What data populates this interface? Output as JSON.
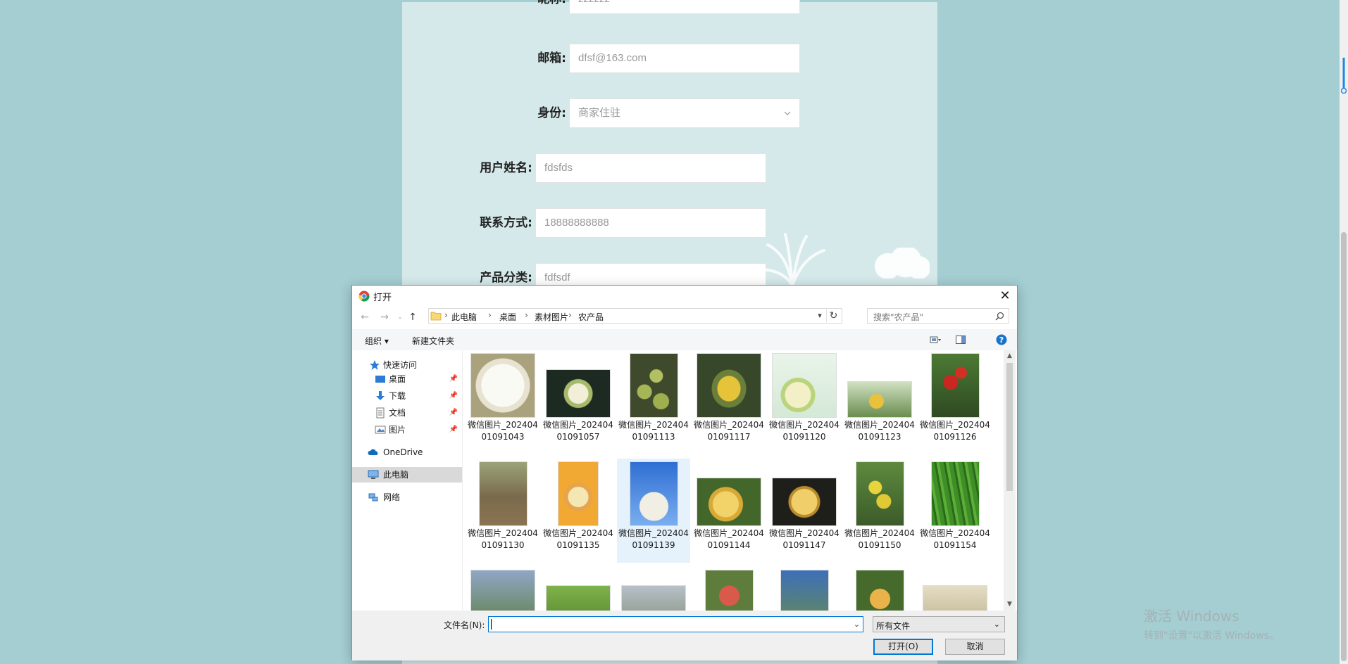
{
  "form": {
    "nickname": {
      "label": "昵称:",
      "value": "zzzzzz"
    },
    "email": {
      "label": "邮箱:",
      "value": "dfsf@163.com"
    },
    "identity": {
      "label": "身份:",
      "value": "商家住驻"
    },
    "username": {
      "label": "用户姓名:",
      "value": "fdsfds"
    },
    "contact": {
      "label": "联系方式:",
      "value": "18888888888"
    },
    "category": {
      "label": "产品分类:",
      "value": "fdfsdf"
    }
  },
  "watermark": {
    "line1": "激活 Windows",
    "line2": "转到\"设置\"以激活 Windows。"
  },
  "dialog": {
    "title": "打开",
    "breadcrumbs": [
      "此电脑",
      "桌面",
      "素材图片",
      "农产品"
    ],
    "search_placeholder": "搜索\"农产品\"",
    "toolbar": {
      "organize": "组织 ▾",
      "new_folder": "新建文件夹"
    },
    "nav": {
      "quick_access": "快速访问",
      "desktop": "桌面",
      "downloads": "下载",
      "documents": "文档",
      "pictures": "图片",
      "onedrive": "OneDrive",
      "this_pc": "此电脑",
      "network": "网络"
    },
    "files": [
      {
        "name": "微信图片_20240401091043"
      },
      {
        "name": "微信图片_20240401091057"
      },
      {
        "name": "微信图片_20240401091113"
      },
      {
        "name": "微信图片_20240401091117"
      },
      {
        "name": "微信图片_20240401091120"
      },
      {
        "name": "微信图片_20240401091123"
      },
      {
        "name": "微信图片_20240401091126"
      },
      {
        "name": "微信图片_20240401091130"
      },
      {
        "name": "微信图片_20240401091135"
      },
      {
        "name": "微信图片_20240401091139"
      },
      {
        "name": "微信图片_20240401091144"
      },
      {
        "name": "微信图片_20240401091147"
      },
      {
        "name": "微信图片_20240401091150"
      },
      {
        "name": "微信图片_20240401091154"
      }
    ],
    "filename_label": "文件名(N):",
    "filename_value": "",
    "file_type": "所有文件",
    "open_button": "打开(O)",
    "cancel_button": "取消"
  },
  "colors": {
    "page_bg": "#a4ced2",
    "panel_bg": "#d5e9ea",
    "accent": "#0078d7"
  }
}
